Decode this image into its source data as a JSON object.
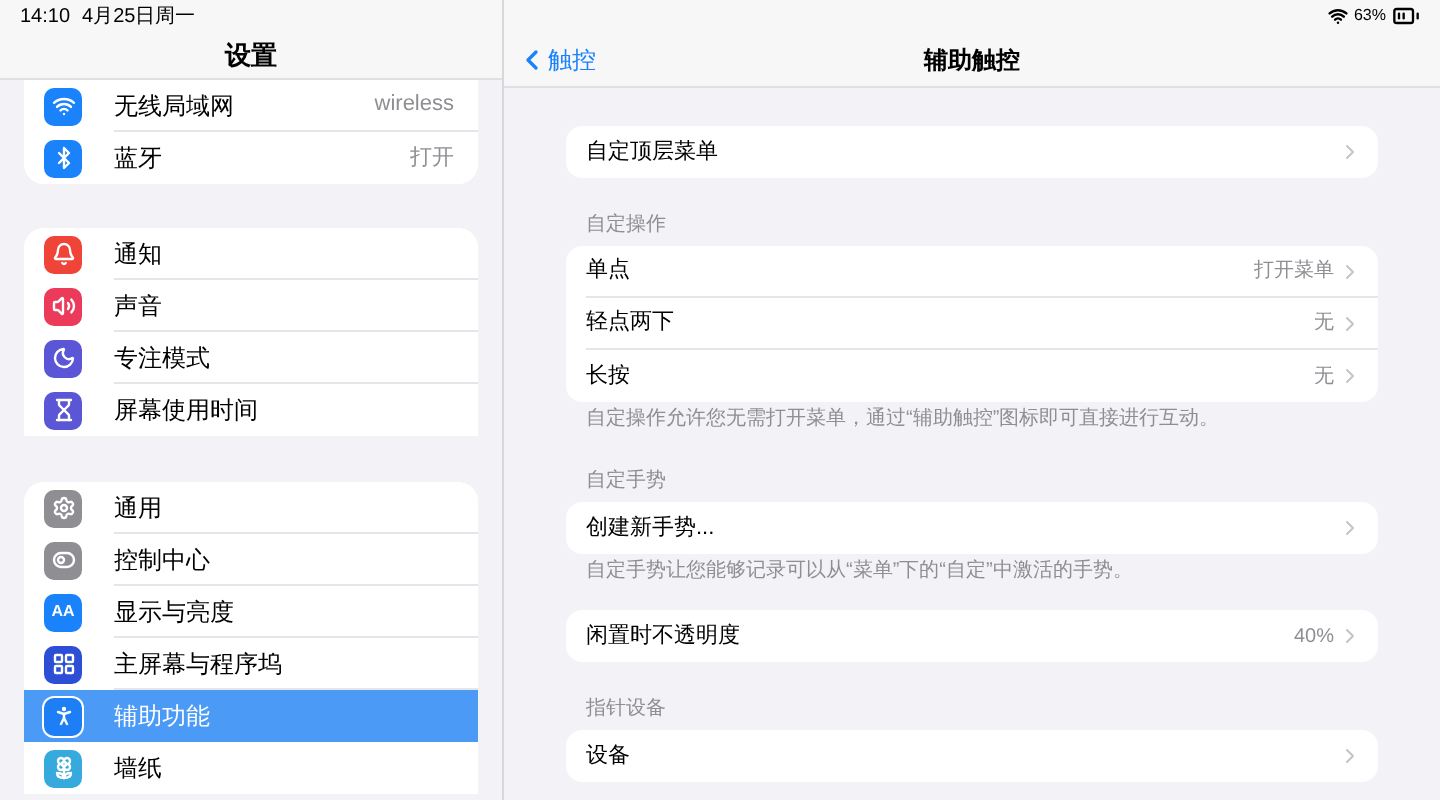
{
  "status_bar": {
    "time": "14:10",
    "date": "4月25日周一",
    "battery": "63%"
  },
  "sidebar": {
    "title": "设置",
    "groups": [
      {
        "items": [
          {
            "label": "无线局域网",
            "value": "wireless",
            "selected": false
          },
          {
            "label": "蓝牙",
            "value": "打开",
            "selected": false
          }
        ]
      },
      {
        "items": [
          {
            "label": "通知",
            "selected": false
          },
          {
            "label": "声音",
            "selected": false
          },
          {
            "label": "专注模式",
            "selected": false
          },
          {
            "label": "屏幕使用时间",
            "selected": false
          }
        ]
      },
      {
        "items": [
          {
            "label": "通用",
            "selected": false
          },
          {
            "label": "控制中心",
            "selected": false
          },
          {
            "label": "显示与亮度",
            "icon_text": "AA",
            "selected": false
          },
          {
            "label": "主屏幕与程序坞",
            "selected": false
          },
          {
            "label": "辅助功能",
            "selected": true
          },
          {
            "label": "墙纸",
            "selected": false
          }
        ]
      }
    ]
  },
  "nav": {
    "back": "触控",
    "title": "辅助触控"
  },
  "sections": [
    {
      "rows": [
        {
          "label": "自定顶层菜单"
        }
      ]
    },
    {
      "header": "自定操作",
      "rows": [
        {
          "label": "单点",
          "value": "打开菜单"
        },
        {
          "label": "轻点两下",
          "value": "无"
        },
        {
          "label": "长按",
          "value": "无"
        }
      ],
      "footer": "自定操作允许您无需打开菜单，通过“辅助触控”图标即可直接进行互动。"
    },
    {
      "header": "自定手势",
      "rows": [
        {
          "label": "创建新手势..."
        }
      ],
      "footer": "自定手势让您能够记录可以从“菜单”下的“自定”中激活的手势。"
    },
    {
      "rows": [
        {
          "label": "闲置时不透明度",
          "value": "40%"
        }
      ]
    },
    {
      "header": "指针设备",
      "rows": [
        {
          "label": "设备"
        }
      ]
    }
  ]
}
